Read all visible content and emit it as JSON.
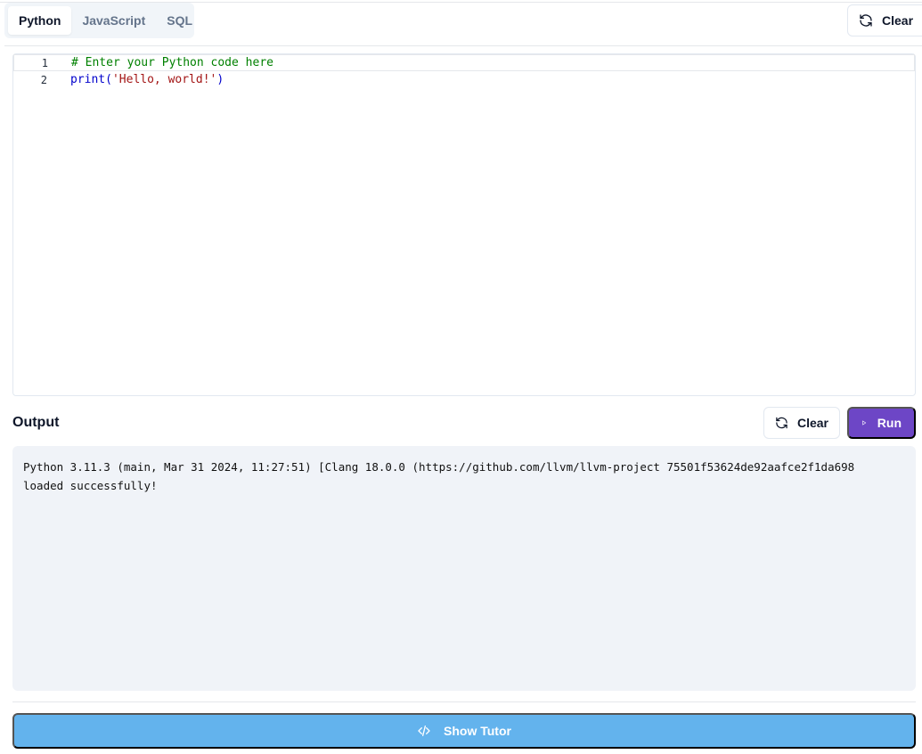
{
  "tabs": [
    {
      "label": "Python",
      "active": true
    },
    {
      "label": "JavaScript",
      "active": false
    },
    {
      "label": "SQL",
      "active": false
    }
  ],
  "header": {
    "clear_label": "Clear",
    "clear_icon": "refresh-icon"
  },
  "editor": {
    "lines": [
      {
        "number": "1",
        "comment": "# Enter your Python code here"
      },
      {
        "number": "2",
        "func": "print",
        "open": "(",
        "string": "'Hello, world!'",
        "close": ")"
      }
    ]
  },
  "output": {
    "title": "Output",
    "clear_label": "Clear",
    "run_label": "Run",
    "run_icon": "play-icon",
    "text": "Python 3.11.3 (main, Mar 31 2024, 11:27:51) [Clang 18.0.0 (https://github.com/llvm/llvm-project 75501f53624de92aafce2f1da698\nloaded successfully!"
  },
  "footer": {
    "tutor_label": "Show Tutor",
    "tutor_icon": "code-icon"
  },
  "colors": {
    "run_button": "#6d46c6",
    "tutor_button": "#63b3ed",
    "output_bg": "#f0f3f8"
  }
}
